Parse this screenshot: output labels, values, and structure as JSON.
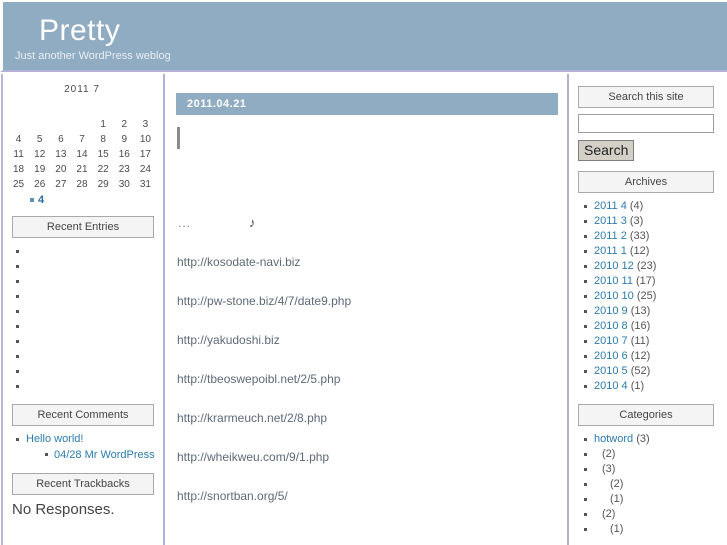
{
  "banner": {
    "title": "Pretty",
    "description": "Just another WordPress weblog",
    "bg_color": "#90acc2"
  },
  "calendar": {
    "caption": "2011  7",
    "weekday_headers": [
      "",
      "",
      "",
      "",
      "",
      "",
      ""
    ],
    "weeks": [
      [
        "",
        "",
        "",
        "",
        "1",
        "2",
        "3"
      ],
      [
        "4",
        "5",
        "6",
        "7",
        "8",
        "9",
        "10"
      ],
      [
        "11",
        "12",
        "13",
        "14",
        "15",
        "16",
        "17"
      ],
      [
        "18",
        "19",
        "20",
        "21",
        "22",
        "23",
        "24"
      ],
      [
        "25",
        "26",
        "27",
        "28",
        "29",
        "30",
        "31"
      ]
    ],
    "prev_link": "4"
  },
  "sidebar_left": {
    "recent_entries": {
      "title": "Recent Entries",
      "items": [
        "",
        "",
        "",
        "",
        "",
        "",
        "",
        "",
        "",
        ""
      ]
    },
    "recent_comments": {
      "title": "Recent Comments",
      "items": [
        {
          "label": "Hello world!",
          "children": [
            {
              "label": "04/28 Mr WordPress"
            }
          ]
        }
      ]
    },
    "recent_trackbacks": {
      "title": "Recent Trackbacks",
      "empty_text": "No Responses."
    }
  },
  "sidebar_right": {
    "search": {
      "title": "Search this site",
      "value": "",
      "placeholder": "",
      "button_label": "Search"
    },
    "archives": {
      "title": "Archives",
      "items": [
        {
          "label": "2011 4",
          "count": "(4)"
        },
        {
          "label": "2011 3",
          "count": "(3)"
        },
        {
          "label": "2011 2",
          "count": "(33)"
        },
        {
          "label": "2011 1",
          "count": "(12)"
        },
        {
          "label": "2010 12",
          "count": "(23)"
        },
        {
          "label": "2010 11",
          "count": "(17)"
        },
        {
          "label": "2010 10",
          "count": "(25)"
        },
        {
          "label": "2010 9",
          "count": "(13)"
        },
        {
          "label": "2010 8",
          "count": "(16)"
        },
        {
          "label": "2010 7",
          "count": "(11)"
        },
        {
          "label": "2010 6",
          "count": "(12)"
        },
        {
          "label": "2010 5",
          "count": "(52)"
        },
        {
          "label": "2010 4",
          "count": "(1)"
        }
      ]
    },
    "categories": {
      "title": "Categories",
      "items": [
        {
          "label": "hotword",
          "count": "(3)",
          "indent": 0
        },
        {
          "label": "",
          "count": "(2)",
          "indent": 1
        },
        {
          "label": "",
          "count": "(3)",
          "indent": 1
        },
        {
          "label": "",
          "count": "(2)",
          "indent": 2
        },
        {
          "label": "",
          "count": "(1)",
          "indent": 2
        },
        {
          "label": "",
          "count": "(2)",
          "indent": 1
        },
        {
          "label": "",
          "count": "(1)",
          "indent": 2
        }
      ]
    }
  },
  "main": {
    "post_date": "2011.04.21",
    "ellipsis": "...",
    "music_note": "♪",
    "links": [
      "http://kosodate-navi.biz",
      "http://pw-stone.biz/4/7/date9.php",
      "http://yakudoshi.biz",
      "http://tbeoswepoibl.net/2/5.php",
      "http://krarmeuch.net/2/8.php",
      "http://wheikweu.com/9/1.php",
      "http://snortban.org/5/"
    ]
  }
}
